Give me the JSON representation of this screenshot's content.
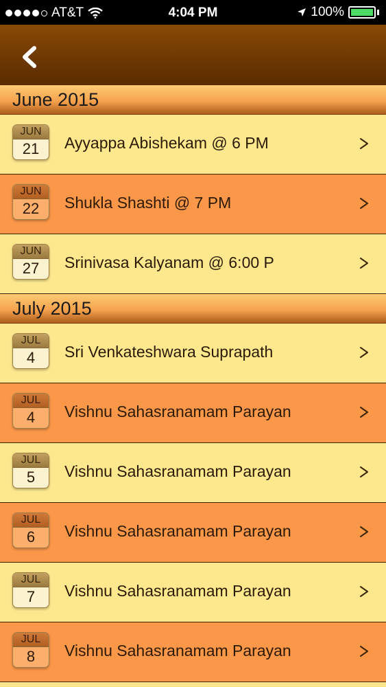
{
  "status": {
    "carrier": "AT&T",
    "time": "4:04 PM",
    "battery": "100%"
  },
  "nav": {
    "back_icon": "chevron-left-icon"
  },
  "sections": [
    {
      "title": "June 2015",
      "events": [
        {
          "month": "JUN",
          "day": "21",
          "title": "Ayyappa Abishekam @ 6 PM",
          "style": "light"
        },
        {
          "month": "JUN",
          "day": "22",
          "title": "Shukla Shashti @ 7 PM",
          "style": "orange"
        },
        {
          "month": "JUN",
          "day": "27",
          "title": "Srinivasa Kalyanam @ 6:00 P",
          "style": "light"
        }
      ]
    },
    {
      "title": "July 2015",
      "events": [
        {
          "month": "JUL",
          "day": "4",
          "title": "Sri Venkateshwara Suprapath",
          "style": "light"
        },
        {
          "month": "JUL",
          "day": "4",
          "title": "Vishnu Sahasranamam Parayan",
          "style": "orange"
        },
        {
          "month": "JUL",
          "day": "5",
          "title": "Vishnu Sahasranamam Parayan",
          "style": "light"
        },
        {
          "month": "JUL",
          "day": "6",
          "title": "Vishnu Sahasranamam Parayan",
          "style": "orange"
        },
        {
          "month": "JUL",
          "day": "7",
          "title": "Vishnu Sahasranamam Parayan",
          "style": "light"
        },
        {
          "month": "JUL",
          "day": "8",
          "title": "Vishnu Sahasranamam Parayan",
          "style": "orange"
        }
      ]
    }
  ],
  "colors": {
    "nav_bar": "#6b3702",
    "row_light": "#fde88e",
    "row_orange": "#fb9749",
    "battery_green": "#4cd964"
  }
}
